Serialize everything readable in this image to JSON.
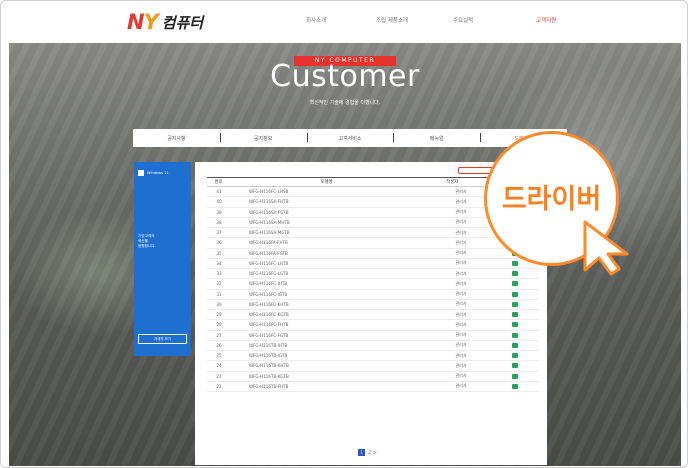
{
  "brand": {
    "logo_latin": "NY",
    "logo_korean": "컴퓨터"
  },
  "nav": {
    "items": [
      {
        "label": "회사소개",
        "active": false
      },
      {
        "label": "조립 제품소개",
        "active": false
      },
      {
        "label": "주요실적",
        "active": false
      },
      {
        "label": "고객지원",
        "active": true
      }
    ]
  },
  "hero": {
    "tag": "NY COMPUTER",
    "title": "Customer",
    "subtitle": "혁신적인 기술에 경험을 더했니다."
  },
  "tabs": [
    {
      "label": "공지사항",
      "active": false
    },
    {
      "label": "공지정보",
      "active": false
    },
    {
      "label": "고객서비스",
      "active": false
    },
    {
      "label": "메뉴얼",
      "active": false
    },
    {
      "label": "드라이버",
      "active": true
    }
  ],
  "windows_card": {
    "title": "Windows 11",
    "text": "기업고객의 \n혁신을 \n응원합니다.",
    "button_label": "자세히 보기"
  },
  "table": {
    "headers": {
      "num": "번호",
      "model": "모델명",
      "writer": "작성자",
      "file": "파일"
    },
    "rows": [
      {
        "num": "41",
        "model": "WFG-H116FC-LHSB",
        "writer": "관리자"
      },
      {
        "num": "40",
        "model": "WFG-H116SA-FHTB",
        "writer": "관리자"
      },
      {
        "num": "39",
        "model": "WFG-H116SA-FGTB",
        "writer": "관리자"
      },
      {
        "num": "38",
        "model": "WFG-H116SA-MHTB",
        "writer": "관리자"
      },
      {
        "num": "37",
        "model": "WFG-H116SA-MGTB",
        "writer": "관리자"
      },
      {
        "num": "36",
        "model": "WFG-H116FA-FHTB",
        "writer": "관리자"
      },
      {
        "num": "35",
        "model": "WFG-H116FA-FGTB",
        "writer": "관리자"
      },
      {
        "num": "34",
        "model": "WFG-H116FC-LHTB",
        "writer": "관리자"
      },
      {
        "num": "33",
        "model": "WFG-H116FC-LGTB",
        "writer": "관리자"
      },
      {
        "num": "32",
        "model": "WFG-H116FC-IHTB",
        "writer": "관리자"
      },
      {
        "num": "31",
        "model": "WFG-H116FC-IGTB",
        "writer": "관리자"
      },
      {
        "num": "30",
        "model": "WFG-H116FC-KHTB",
        "writer": "관리자"
      },
      {
        "num": "29",
        "model": "WFG-H116FC-KGTB",
        "writer": "관리자"
      },
      {
        "num": "28",
        "model": "WFG-H116FC-FHTB",
        "writer": "관리자"
      },
      {
        "num": "27",
        "model": "WFG-H116FC-FGTB",
        "writer": "관리자"
      },
      {
        "num": "26",
        "model": "WFG-H116TB-IHTB",
        "writer": "관리자"
      },
      {
        "num": "25",
        "model": "WFG-H116TB-IGTB",
        "writer": "관리자"
      },
      {
        "num": "24",
        "model": "WFG-H116TB-KHTB",
        "writer": "관리자"
      },
      {
        "num": "23",
        "model": "WFG-H116TB-KGTB",
        "writer": "관리자"
      },
      {
        "num": "22",
        "model": "WFG-H116TB-FHTB",
        "writer": "관리자"
      }
    ]
  },
  "pagination": {
    "current": "1",
    "next": "2 >"
  },
  "callout": {
    "label": "드라이버"
  },
  "colors": {
    "brand_red": "#e33a2f",
    "brand_orange": "#f19a1b",
    "callout_orange": "#ff8a2a",
    "windows_blue": "#1e6fd0",
    "file_green": "#27a35a"
  },
  "icons": {
    "file": "file-download-icon",
    "cursor": "pointer-cursor-icon",
    "windows": "windows-logo-icon"
  }
}
